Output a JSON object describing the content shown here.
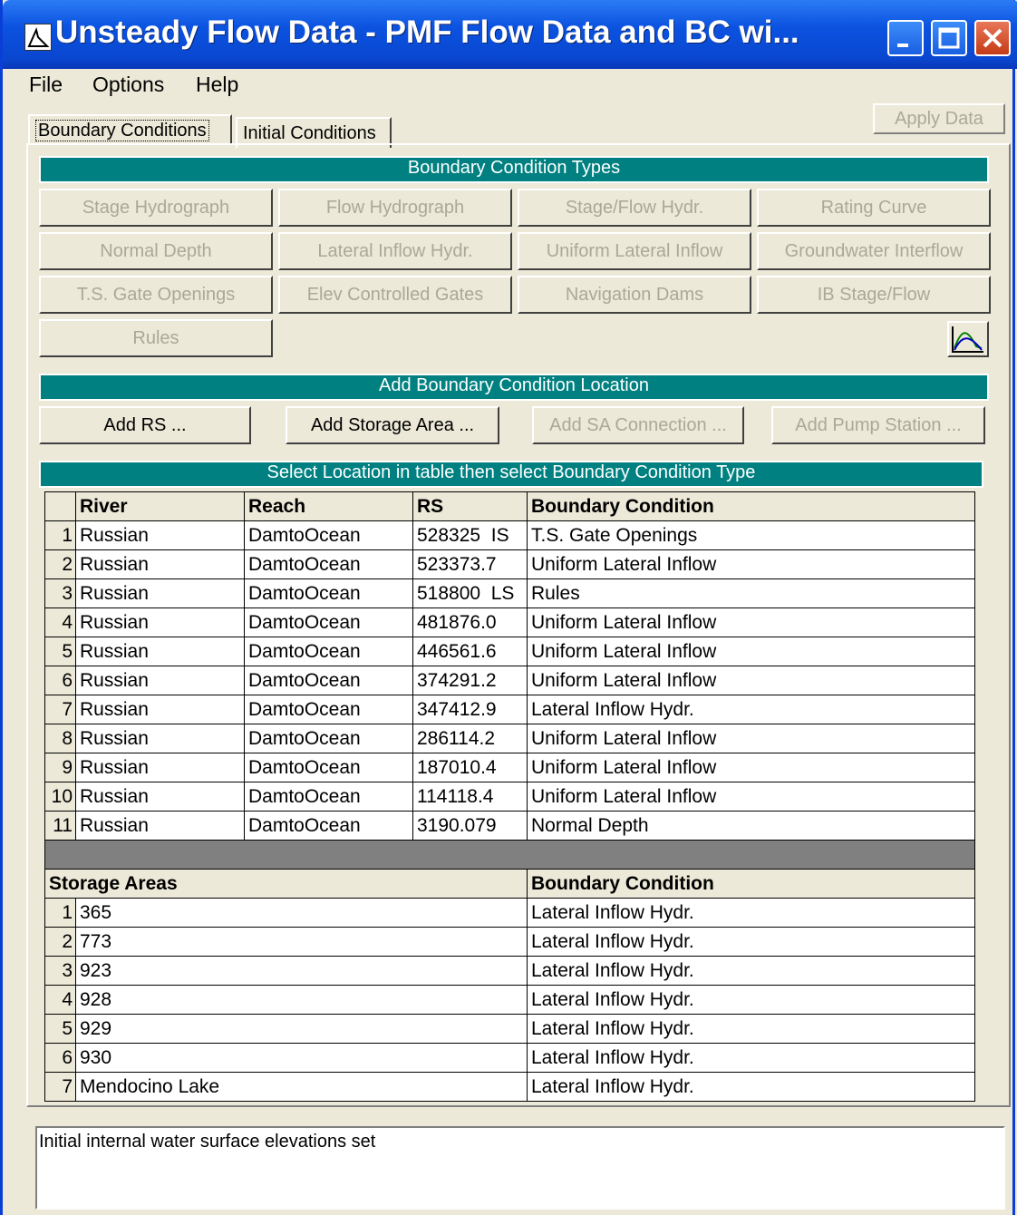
{
  "window": {
    "title": "Unsteady Flow Data - PMF Flow Data and BC wi..."
  },
  "menu": [
    "File",
    "Options",
    "Help"
  ],
  "tabs": {
    "active": "Boundary Conditions",
    "inactive": "Initial Conditions"
  },
  "apply_button": "Apply Data",
  "bc_types": {
    "header": "Boundary Condition Types",
    "buttons": [
      "Stage Hydrograph",
      "Flow Hydrograph",
      "Stage/Flow Hydr.",
      "Rating Curve",
      "Normal Depth",
      "Lateral Inflow Hydr.",
      "Uniform Lateral Inflow",
      "Groundwater Interflow",
      "T.S. Gate Openings",
      "Elev Controlled Gates",
      "Navigation Dams",
      "IB Stage/Flow",
      "Rules"
    ]
  },
  "add_location": {
    "header": "Add Boundary Condition Location",
    "buttons": [
      "Add RS ...",
      "Add Storage Area ...",
      "Add SA Connection ...",
      "Add Pump Station ..."
    ]
  },
  "table": {
    "header": "Select Location in table then select Boundary Condition Type",
    "columns": [
      "River",
      "Reach",
      "RS",
      "Boundary Condition"
    ],
    "rows": [
      [
        "1",
        "Russian",
        "DamtoOcean",
        "528325  IS",
        "T.S. Gate Openings"
      ],
      [
        "2",
        "Russian",
        "DamtoOcean",
        "523373.7",
        "Uniform Lateral Inflow"
      ],
      [
        "3",
        "Russian",
        "DamtoOcean",
        "518800  LS",
        "Rules"
      ],
      [
        "4",
        "Russian",
        "DamtoOcean",
        "481876.0",
        "Uniform Lateral Inflow"
      ],
      [
        "5",
        "Russian",
        "DamtoOcean",
        "446561.6",
        "Uniform Lateral Inflow"
      ],
      [
        "6",
        "Russian",
        "DamtoOcean",
        "374291.2",
        "Uniform Lateral Inflow"
      ],
      [
        "7",
        "Russian",
        "DamtoOcean",
        "347412.9",
        "Lateral Inflow Hydr."
      ],
      [
        "8",
        "Russian",
        "DamtoOcean",
        "286114.2",
        "Uniform Lateral Inflow"
      ],
      [
        "9",
        "Russian",
        "DamtoOcean",
        "187010.4",
        "Uniform Lateral Inflow"
      ],
      [
        "10",
        "Russian",
        "DamtoOcean",
        "114118.4",
        "Uniform Lateral Inflow"
      ],
      [
        "11",
        "Russian",
        "DamtoOcean",
        "3190.079",
        "Normal Depth"
      ]
    ],
    "storage_columns": [
      "Storage Areas",
      "Boundary Condition"
    ],
    "storage_rows": [
      [
        "1",
        "365",
        "Lateral Inflow Hydr."
      ],
      [
        "2",
        "773",
        "Lateral Inflow Hydr."
      ],
      [
        "3",
        "923",
        "Lateral Inflow Hydr."
      ],
      [
        "4",
        "928",
        "Lateral Inflow Hydr."
      ],
      [
        "5",
        "929",
        "Lateral Inflow Hydr."
      ],
      [
        "6",
        "930",
        "Lateral Inflow Hydr."
      ],
      [
        "7",
        "Mendocino Lake",
        "Lateral Inflow Hydr."
      ]
    ]
  },
  "status": "Initial internal water surface elevations set",
  "icons": [
    "app-icon",
    "minimize-icon",
    "maximize-icon",
    "close-icon",
    "plot-icon"
  ]
}
